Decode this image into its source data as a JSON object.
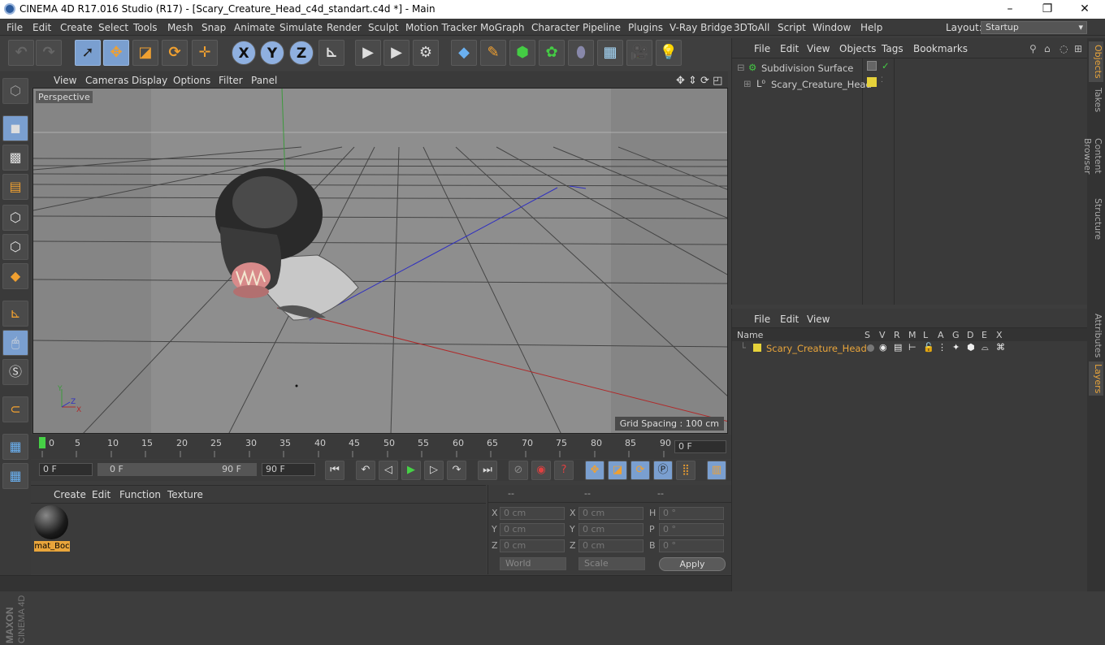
{
  "window": {
    "title": "CINEMA 4D R17.016 Studio (R17) - [Scary_Creature_Head_c4d_standart.c4d *] - Main",
    "minimize": "–",
    "maximize": "❐",
    "close": "✕"
  },
  "menubar": {
    "items": [
      "File",
      "Edit",
      "Create",
      "Select",
      "Tools",
      "Mesh",
      "Snap",
      "Animate",
      "Simulate",
      "Render",
      "Sculpt",
      "Motion Tracker",
      "MoGraph",
      "Character",
      "Pipeline",
      "Plugins",
      "V-Ray Bridge",
      "3DToAll",
      "Script",
      "Window",
      "Help"
    ],
    "layout_label": "Layout:",
    "layout_value": "Startup"
  },
  "toolbar": {
    "x": "X",
    "y": "Y",
    "z": "Z"
  },
  "viewport": {
    "menu": [
      "View",
      "Cameras",
      "Display",
      "Options",
      "Filter",
      "Panel"
    ],
    "label": "Perspective",
    "grid_spacing": "Grid Spacing : 100 cm"
  },
  "timeline": {
    "ticks": [
      "0",
      "5",
      "10",
      "15",
      "20",
      "25",
      "30",
      "35",
      "40",
      "45",
      "50",
      "55",
      "60",
      "65",
      "70",
      "75",
      "80",
      "85",
      "90"
    ],
    "current_frame": "0 F"
  },
  "playback": {
    "start": "0 F",
    "range_start": "0 F",
    "range_end": "90 F",
    "end": "90 F"
  },
  "material_panel": {
    "menu": [
      "Create",
      "Edit",
      "Function",
      "Texture"
    ],
    "material_name": "mat_Boc"
  },
  "coordinates": {
    "headers": [
      "--",
      "--",
      "--"
    ],
    "pos_x": "0 cm",
    "pos_y": "0 cm",
    "pos_z": "0 cm",
    "size_x": "0 cm",
    "size_y": "0 cm",
    "size_z": "0 cm",
    "rot_h": "0 °",
    "rot_p": "0 °",
    "rot_b": "0 °",
    "labels": {
      "x": "X",
      "y": "Y",
      "z": "Z",
      "h": "H",
      "p": "P",
      "b": "B"
    },
    "mode": "World",
    "scale": "Scale",
    "apply": "Apply"
  },
  "objects_panel": {
    "menu": [
      "File",
      "Edit",
      "View",
      "Objects",
      "Tags",
      "Bookmarks"
    ],
    "items": [
      {
        "name": "Subdivision Surface"
      },
      {
        "name": "Scary_Creature_Head"
      }
    ]
  },
  "layers_panel": {
    "menu": [
      "File",
      "Edit",
      "View"
    ],
    "name_header": "Name",
    "columns": [
      "S",
      "V",
      "R",
      "M",
      "L",
      "A",
      "G",
      "D",
      "E",
      "X"
    ],
    "layer_name": "Scary_Creature_Head"
  },
  "side_tabs": [
    "Objects",
    "Takes",
    "Content Browser",
    "Structure",
    "Attributes",
    "Layers"
  ],
  "logo": {
    "maxon": "MAXON",
    "product": "CINEMA 4D"
  },
  "colors": {
    "accent": "#e9a53b",
    "selected": "#7a9fd0",
    "layer": "#e6d23a"
  }
}
